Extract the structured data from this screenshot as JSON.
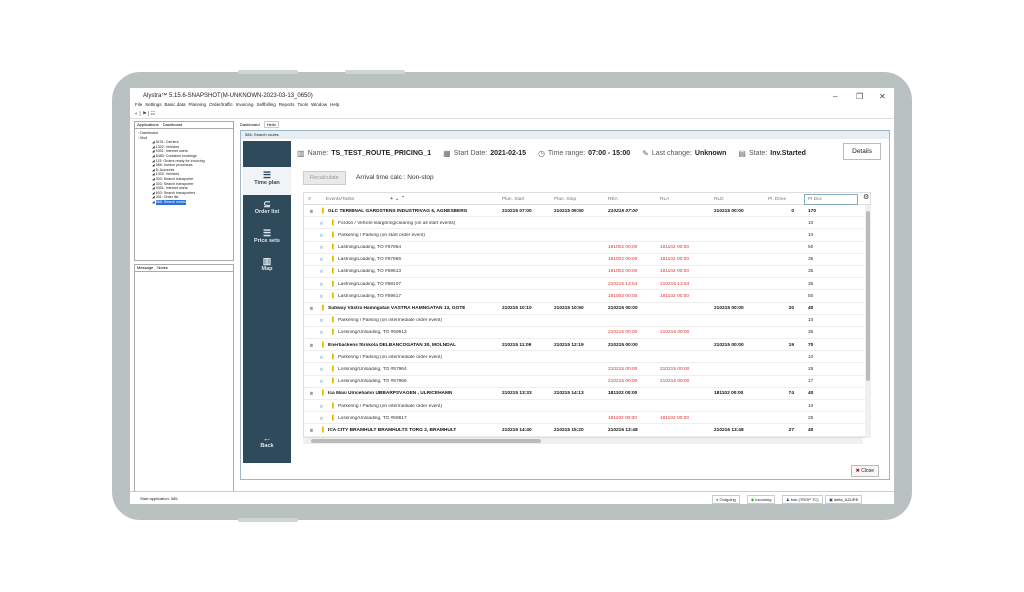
{
  "app": {
    "title": "Alystra™ 5.15.6-SNAPSHOT(M-UNKNOWN-2023-03-13_0650)",
    "menu": [
      "File",
      "Settings",
      "Basic data",
      "Planning",
      "Order/traffic",
      "Invoicing",
      "Selfbilling",
      "Reports",
      "Tools",
      "Window",
      "Help"
    ]
  },
  "left_panel": {
    "tabs": [
      "Applications",
      "Dashboard"
    ],
    "tree": [
      "Dashboard",
      "Mod",
      "5101: Carriers",
      "1302: Vehicles",
      "9301: Internet users",
      "5480: Container bookings",
      "115: Orders ready for invoicing",
      "586: Invoice processes",
      "8: Accounts",
      "1302: Vehicles",
      "303: Search transporter",
      "303: Search transporter",
      "9301: Internet users",
      "603: Search transporters",
      "301: Order list",
      "586: Search routes"
    ],
    "message_tabs": [
      "Message",
      "Notes"
    ]
  },
  "dashboard_tabs": [
    "Dashboard",
    "Hello"
  ],
  "inner_window_title": "586: Search routes",
  "nav": [
    {
      "label": "Time plan",
      "icon": "list-icon"
    },
    {
      "label": "Order list",
      "icon": "order-list-icon"
    },
    {
      "label": "Price sets",
      "icon": "price-list-icon"
    },
    {
      "label": "Map",
      "icon": "map-icon"
    },
    {
      "label": "Back",
      "icon": "back-arrow-icon"
    }
  ],
  "header": {
    "name_label": "Name:",
    "name": "TS_TEST_ROUTE_PRICING_1",
    "start_label": "Start Date:",
    "start": "2021-02-15",
    "range_label": "Time range:",
    "range": "07:00 - 15:00",
    "change_label": "Last change:",
    "change": "Unknown",
    "state_label": "State:",
    "state": "Inv.Started",
    "details": "Details"
  },
  "recalculate": "Recalculate",
  "arrival": "Arrival time calc : Non-stop",
  "columns": [
    "Events/Tasks",
    "Plan. Start",
    "Plan. Stop",
    "REA",
    "RLA",
    "RLD",
    "Pl. Drive",
    "Pl Dur."
  ],
  "rows": [
    {
      "g": true,
      "t": "GLC TERMINAL GÅRDSTENS INDUSTRIVÄG 6, AGNESBERG",
      "ps": "210215 07:00",
      "pe": "210215 09:50",
      "rea": "210215 07:00",
      "rla": "",
      "rld": "210215 00:00",
      "drive": "0",
      "dur": "170"
    },
    {
      "g": false,
      "t": "Fordon / Vehicle klargöring/clearing (on all start events)",
      "ps": "",
      "pe": "",
      "rea": "",
      "rla": "",
      "rld": "",
      "drive": "",
      "dur": "10"
    },
    {
      "g": false,
      "t": "Parkering / Parking (on start order event)",
      "ps": "",
      "pe": "",
      "rea": "",
      "rla": "",
      "rld": "",
      "drive": "",
      "dur": "10"
    },
    {
      "g": false,
      "t": "Lastning/Loading, TO #57964",
      "ps": "",
      "pe": "",
      "rea": "181002 00:00",
      "rla": "181102 00:00",
      "rld": "",
      "drive": "",
      "dur": "50"
    },
    {
      "g": false,
      "t": "Lastning/Loading, TO #57966",
      "ps": "",
      "pe": "",
      "rea": "181002 00:00",
      "rla": "181102 00:00",
      "rld": "",
      "drive": "",
      "dur": "35"
    },
    {
      "g": false,
      "t": "Lastning/Loading, TO #59613",
      "ps": "",
      "pe": "",
      "rea": "181002 00:00",
      "rla": "181102 00:00",
      "rld": "",
      "drive": "",
      "dur": "35"
    },
    {
      "g": false,
      "t": "Lastning/Loading, TO #58107",
      "ps": "",
      "pe": "",
      "rea": "210215 13:54",
      "rla": "210215 13:54",
      "rld": "",
      "drive": "",
      "dur": "35"
    },
    {
      "g": false,
      "t": "Lastning/Loading, TO #59617",
      "ps": "",
      "pe": "",
      "rea": "181002 00:00",
      "rla": "181102 00:00",
      "rld": "",
      "drive": "",
      "dur": "50"
    },
    {
      "g": true,
      "t": "Subway Västra Hamngatan VÄSTRA HAMNGATAN 13, GÖTE",
      "ps": "210215 10:10",
      "pe": "210215 10:50",
      "rea": "210215 00:00",
      "rla": "",
      "rld": "210215 00:00",
      "drive": "20",
      "dur": "40"
    },
    {
      "g": false,
      "t": "Parkering / Parking (on intermediate order event)",
      "ps": "",
      "pe": "",
      "rea": "",
      "rla": "",
      "rld": "",
      "drive": "",
      "dur": "10"
    },
    {
      "g": false,
      "t": "Lossning/Unloading, TO #59613",
      "ps": "",
      "pe": "",
      "rea": "210215 00:00",
      "rla": "210215 00:00",
      "rld": "",
      "drive": "",
      "dur": "35"
    },
    {
      "g": true,
      "t": "Enerbackens förskola DELBANCOGATAN 30, MÖLNDAL",
      "ps": "210215 11:09",
      "pe": "210215 12:19",
      "rea": "210215 00:00",
      "rla": "",
      "rld": "210215 00:00",
      "drive": "19",
      "dur": "70"
    },
    {
      "g": false,
      "t": "Parkering / Parking (on intermediate order event)",
      "ps": "",
      "pe": "",
      "rea": "",
      "rla": "",
      "rld": "",
      "drive": "",
      "dur": "10"
    },
    {
      "g": false,
      "t": "Lossning/Unloading, TO #57964",
      "ps": "",
      "pe": "",
      "rea": "210215 00:00",
      "rla": "210215 00:00",
      "rld": "",
      "drive": "",
      "dur": "25"
    },
    {
      "g": false,
      "t": "Lossning/Unloading, TO #57966",
      "ps": "",
      "pe": "",
      "rea": "210215 00:00",
      "rla": "210215 00:00",
      "rld": "",
      "drive": "",
      "dur": "17"
    },
    {
      "g": true,
      "t": "Ica Maxi Ulricehamn UBBARPSVÄGEN , ULRICEHAMN",
      "ps": "210215 13:33",
      "pe": "210215 14:13",
      "rea": "181102 00:00",
      "rla": "",
      "rld": "181102 00:00",
      "drive": "74",
      "dur": "40"
    },
    {
      "g": false,
      "t": "Parkering / Parking (on intermediate order event)",
      "ps": "",
      "pe": "",
      "rea": "",
      "rla": "",
      "rld": "",
      "drive": "",
      "dur": "10"
    },
    {
      "g": false,
      "t": "Lossning/Unloading, TO #59617",
      "ps": "",
      "pe": "",
      "rea": "181102 00:00",
      "rla": "181102 00:00",
      "rld": "",
      "drive": "",
      "dur": "25"
    },
    {
      "g": true,
      "t": "ICA CITY BRÄMHULT BRÄMHULTS TORG 2, BRÄMHULT",
      "ps": "210215 14:40",
      "pe": "210215 15:20",
      "rea": "210215 13:48",
      "rla": "",
      "rld": "210216 13:48",
      "drive": "27",
      "dur": "40"
    }
  ],
  "close": "Close",
  "status": {
    "left": "Start application: 586",
    "outgoing": "Outgoing",
    "incoming": "Incoming",
    "user": "bob (TROP TC)",
    "server": "delta_AZURE"
  }
}
